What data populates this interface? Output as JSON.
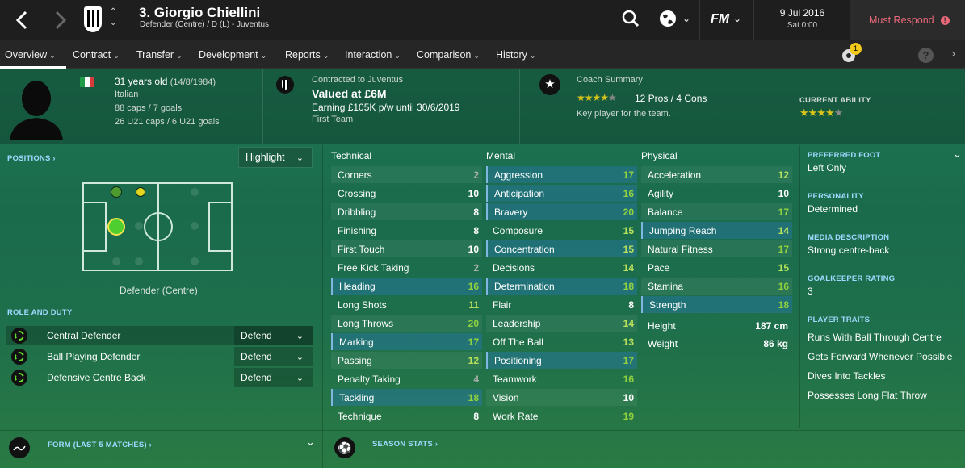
{
  "header": {
    "title": "3. Giorgio Chiellini",
    "subtitle": "Defender (Centre) / D (L) - Juventus",
    "date": "9 Jul 2016",
    "time": "Sat 0:00",
    "must_respond": "Must Respond",
    "fm_logo": "FM",
    "notification_count": "1"
  },
  "nav": [
    "Overview",
    "Contract",
    "Transfer",
    "Development",
    "Reports",
    "Interaction",
    "Comparison",
    "History"
  ],
  "profile": {
    "age": "31 years old",
    "dob": "(14/8/1984)",
    "nationality": "Italian",
    "caps": "88 caps / 7 goals",
    "u21": "26 U21 caps / 6 U21 goals",
    "contracted": "Contracted to Juventus",
    "value": "Valued at £6M",
    "earning": "Earning £105K p/w until 30/6/2019",
    "squad": "First Team",
    "coach_label": "Coach Summary",
    "pros_cons": "12 Pros / 4 Cons",
    "coach_text": "Key player for the team.",
    "current_ability_label": "CURRENT ABILITY"
  },
  "positions": {
    "label": "POSITIONS ›",
    "highlight": "Highlight",
    "position_text": "Defender (Centre)",
    "role_label": "ROLE AND DUTY"
  },
  "roles": [
    {
      "name": "Central Defender",
      "duty": "Defend"
    },
    {
      "name": "Ball Playing Defender",
      "duty": "Defend"
    },
    {
      "name": "Defensive Centre Back",
      "duty": "Defend"
    }
  ],
  "headers": {
    "technical": "Technical",
    "mental": "Mental",
    "physical": "Physical"
  },
  "technical": [
    {
      "name": "Corners",
      "value": "2"
    },
    {
      "name": "Crossing",
      "value": "10"
    },
    {
      "name": "Dribbling",
      "value": "8"
    },
    {
      "name": "Finishing",
      "value": "8"
    },
    {
      "name": "First Touch",
      "value": "10"
    },
    {
      "name": "Free Kick Taking",
      "value": "2"
    },
    {
      "name": "Heading",
      "value": "16"
    },
    {
      "name": "Long Shots",
      "value": "11"
    },
    {
      "name": "Long Throws",
      "value": "20"
    },
    {
      "name": "Marking",
      "value": "17"
    },
    {
      "name": "Passing",
      "value": "12"
    },
    {
      "name": "Penalty Taking",
      "value": "4"
    },
    {
      "name": "Tackling",
      "value": "18"
    },
    {
      "name": "Technique",
      "value": "8"
    }
  ],
  "mental": [
    {
      "name": "Aggression",
      "value": "17"
    },
    {
      "name": "Anticipation",
      "value": "16"
    },
    {
      "name": "Bravery",
      "value": "20"
    },
    {
      "name": "Composure",
      "value": "15"
    },
    {
      "name": "Concentration",
      "value": "15"
    },
    {
      "name": "Decisions",
      "value": "14"
    },
    {
      "name": "Determination",
      "value": "18"
    },
    {
      "name": "Flair",
      "value": "8"
    },
    {
      "name": "Leadership",
      "value": "14"
    },
    {
      "name": "Off The Ball",
      "value": "13"
    },
    {
      "name": "Positioning",
      "value": "17"
    },
    {
      "name": "Teamwork",
      "value": "16"
    },
    {
      "name": "Vision",
      "value": "10"
    },
    {
      "name": "Work Rate",
      "value": "19"
    }
  ],
  "physical": [
    {
      "name": "Acceleration",
      "value": "12"
    },
    {
      "name": "Agility",
      "value": "10"
    },
    {
      "name": "Balance",
      "value": "17"
    },
    {
      "name": "Jumping Reach",
      "value": "14"
    },
    {
      "name": "Natural Fitness",
      "value": "17"
    },
    {
      "name": "Pace",
      "value": "15"
    },
    {
      "name": "Stamina",
      "value": "16"
    },
    {
      "name": "Strength",
      "value": "18"
    }
  ],
  "measurements": [
    {
      "name": "Height",
      "value": "187 cm"
    },
    {
      "name": "Weight",
      "value": "86 kg"
    }
  ],
  "side": {
    "foot_label": "PREFERRED FOOT",
    "foot": "Left Only",
    "personality_label": "PERSONALITY",
    "personality": "Determined",
    "media_label": "MEDIA DESCRIPTION",
    "media": "Strong centre-back",
    "gk_label": "GOALKEEPER RATING",
    "gk": "3",
    "traits_label": "PLAYER TRAITS",
    "traits": [
      "Runs With Ball Through Centre",
      "Gets Forward Whenever Possible",
      "Dives Into Tackles",
      "Possesses Long Flat Throw"
    ]
  },
  "footer": {
    "form": "FORM (LAST 5 MATCHES) ›",
    "season": "SEASON STATS ›"
  },
  "colors": {
    "accent": "#9fd9ff",
    "must_respond": "#e8687a",
    "star": "#d8c31a"
  }
}
